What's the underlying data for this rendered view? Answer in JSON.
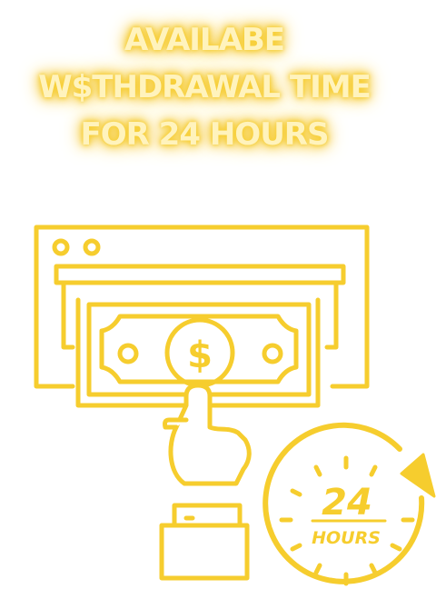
{
  "headline": {
    "line1": "AVAILABE",
    "line2": "W$THDRAWAL TIME",
    "line3": "FOR 24 HOURS"
  },
  "timer": {
    "number": "24",
    "unit": "HOURS"
  },
  "bill": {
    "symbol": "$"
  },
  "colors": {
    "accent": "#f6cd2e",
    "glow": "#f3c21e",
    "text_core": "#fff3bd"
  },
  "icons": {
    "atm": "atm-machine-icon",
    "bill": "dollar-bill-icon",
    "hand": "hand-icon",
    "timer": "24-hour-timer-icon"
  }
}
